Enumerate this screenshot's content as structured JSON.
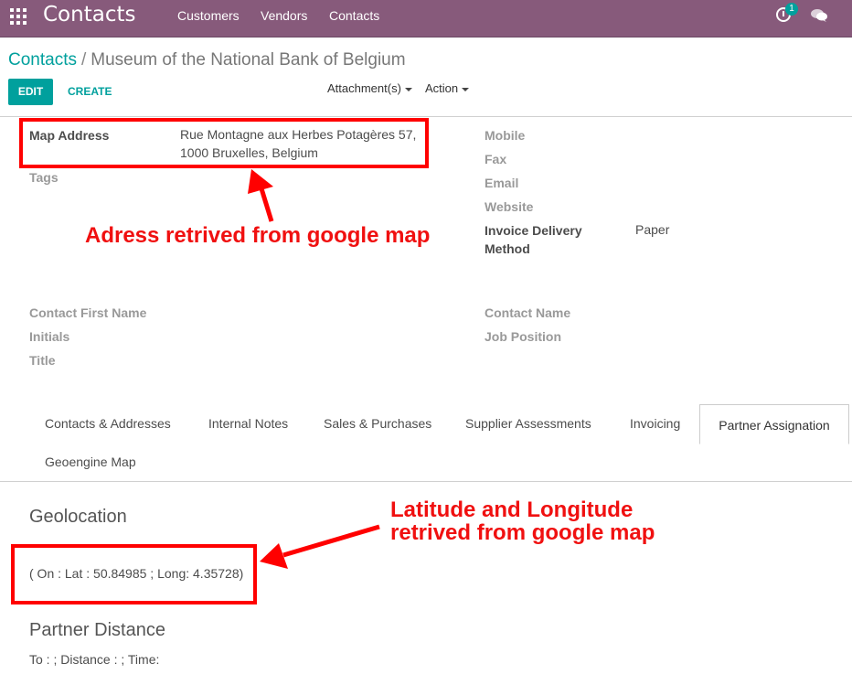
{
  "navbar": {
    "brand": "Contacts",
    "menu": [
      "Customers",
      "Vendors",
      "Contacts"
    ],
    "activity_count": "1",
    "color": "#875a7b"
  },
  "breadcrumb": {
    "parent": "Contacts",
    "separator": "/",
    "current": "Museum of the National Bank of Belgium"
  },
  "buttons": {
    "edit": "EDIT",
    "create": "CREATE",
    "attachments": "Attachment(s)",
    "action": "Action"
  },
  "form": {
    "map_address_label": "Map Address",
    "map_address_line1": "Rue Montagne aux Herbes Potagères 57,",
    "map_address_line2": "1000 Bruxelles, Belgium",
    "tags_label": "Tags",
    "mobile_label": "Mobile",
    "fax_label": "Fax",
    "email_label": "Email",
    "website_label": "Website",
    "invoice_label_line1": "Invoice Delivery",
    "invoice_label_line2": "Method",
    "invoice_value": "Paper",
    "contact_first_name_label": "Contact First Name",
    "initials_label": "Initials",
    "title_label": "Title",
    "contact_name_label": "Contact Name",
    "job_position_label": "Job Position"
  },
  "annotations": {
    "address_note": "Adress retrived from google map",
    "latlong_note_line1": "Latitude and Longitude",
    "latlong_note_line2": "retrived from google map",
    "color": "#ff0000"
  },
  "tabs": [
    "Contacts & Addresses",
    "Internal Notes",
    "Sales & Purchases",
    "Supplier Assessments",
    "Invoicing",
    "Partner Assignation",
    "Geoengine Map"
  ],
  "geolocation": {
    "title": "Geolocation",
    "value": "( On : Lat : 50.84985 ; Long: 4.35728)"
  },
  "partner_distance": {
    "title": "Partner Distance",
    "value": "To : ; Distance : ; Time:"
  },
  "accent_color": "#00a09d"
}
